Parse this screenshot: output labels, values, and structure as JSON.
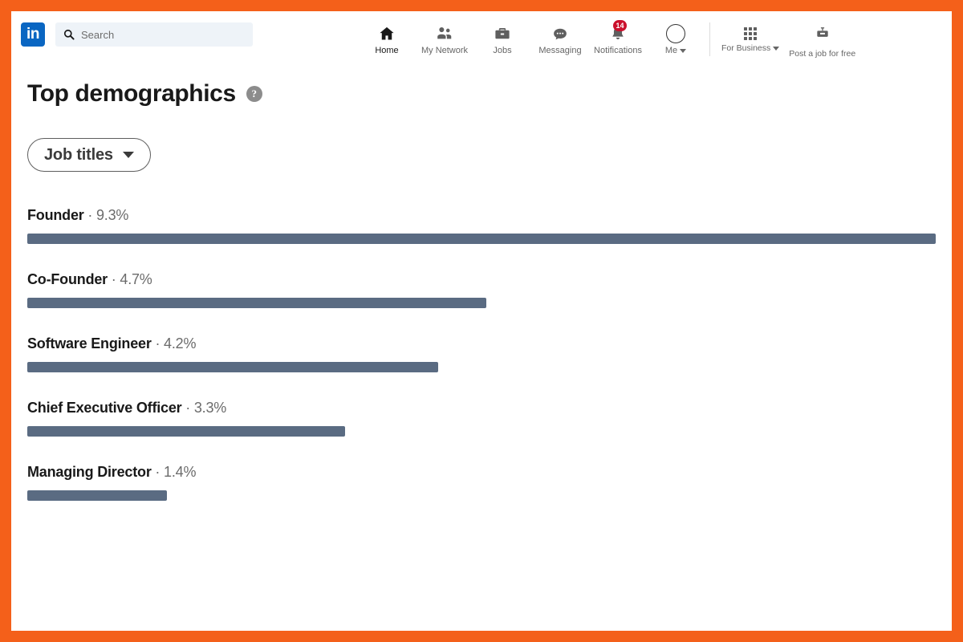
{
  "theme": {
    "border_color": "#F4601A",
    "brand_color": "#0A66C2",
    "bar_color": "#5a6b82",
    "badge_color": "#cb112d"
  },
  "header": {
    "logo_text": "in",
    "search": {
      "placeholder": "Search",
      "value": ""
    },
    "nav_items": [
      {
        "label": "Home",
        "icon": "home-icon",
        "active": true
      },
      {
        "label": "My Network",
        "icon": "people-icon",
        "active": false
      },
      {
        "label": "Jobs",
        "icon": "briefcase-icon",
        "active": false
      },
      {
        "label": "Messaging",
        "icon": "message-bubble-icon",
        "active": false
      },
      {
        "label": "Notifications",
        "icon": "bell-icon",
        "active": false,
        "badge": "14"
      },
      {
        "label": "Me",
        "icon": "avatar-icon",
        "active": false
      }
    ],
    "business_items": [
      {
        "label": "For Business",
        "icon": "grid-icon",
        "has_caret": true
      },
      {
        "label": "Post a job for free",
        "icon": "post-job-icon",
        "has_caret": false
      }
    ]
  },
  "main": {
    "page_title": "Top demographics",
    "help_icon_glyph": "?",
    "filter": {
      "label": "Job titles",
      "icon": "chevron-down-icon"
    }
  },
  "chart_data": {
    "type": "bar",
    "title": "Top demographics",
    "subtitle": "Job titles",
    "orientation": "horizontal",
    "xlabel": "",
    "ylabel": "",
    "xlim": [
      0,
      9.3
    ],
    "grid": false,
    "legend": false,
    "unit": "%",
    "separator": "·",
    "categories": [
      "Founder",
      "Co-Founder",
      "Software Engineer",
      "Chief Executive Officer",
      "Managing Director"
    ],
    "values": [
      9.3,
      4.7,
      4.2,
      3.3,
      1.4
    ],
    "labels": [
      "9.3%",
      "4.7%",
      "4.2%",
      "3.3%",
      "1.4%"
    ],
    "rows": [
      {
        "name": "Founder",
        "value": 9.3,
        "label": "9.3%",
        "width_pct": 100.0
      },
      {
        "name": "Co-Founder",
        "value": 4.7,
        "label": "4.7%",
        "width_pct": 50.5
      },
      {
        "name": "Software Engineer",
        "value": 4.2,
        "label": "4.2%",
        "width_pct": 45.2
      },
      {
        "name": "Chief Executive Officer",
        "value": 3.3,
        "label": "3.3%",
        "width_pct": 35.0
      },
      {
        "name": "Managing Director",
        "value": 1.4,
        "label": "1.4%",
        "width_pct": 15.4
      }
    ]
  }
}
